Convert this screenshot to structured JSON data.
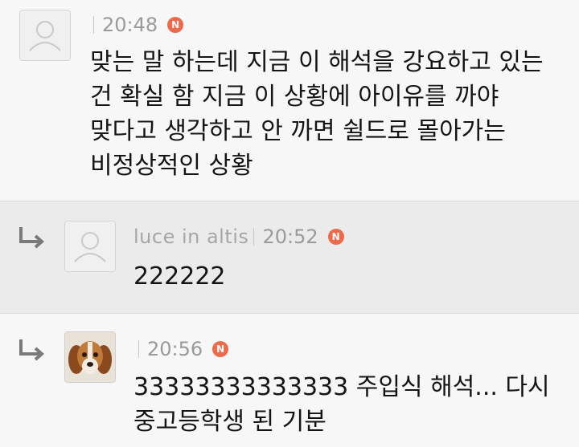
{
  "comments": [
    {
      "author": "",
      "time": "20:48",
      "new_badge": "N",
      "text": "맞는 말 하는데 지금 이 해석을 강요하고 있는\n건 확실 함 지금 이 상황에 아이유를 까야\n맞다고 생각하고 안 까면 쉴드로 몰아가는\n비정상적인 상황",
      "avatar": "default-user-icon"
    },
    {
      "author": "luce in altis",
      "time": "20:52",
      "new_badge": "N",
      "text": "222222",
      "avatar": "default-user-icon",
      "reply_icon": "reply-arrow-icon"
    },
    {
      "author": "",
      "time": "20:56",
      "new_badge": "N",
      "text": "33333333333333 주입식 해석... 다시\n중고등학생 된 기분",
      "avatar": "puppy-photo",
      "reply_icon": "reply-arrow-icon"
    }
  ],
  "colors": {
    "new_badge": "#ee6a4a",
    "meta_text": "#9a9a9a",
    "reply_row_bg": "#ebebeb"
  }
}
